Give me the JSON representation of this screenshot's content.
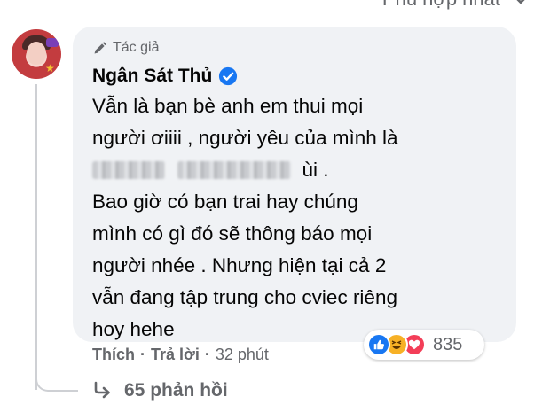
{
  "sort": {
    "label": "Phù hợp nhất"
  },
  "comment": {
    "badge_label": "Tác giả",
    "author": "Ngân Sát Thủ",
    "lines": [
      "Vẫn là bạn bè anh em thui mọi",
      "người ơiiii , người yêu của mình là",
      "ùi .",
      "Bao giờ có bạn trai hay chúng",
      "mình có gì đó sẽ thông báo mọi",
      "người nhée . Nhưng hiện tại cả 2",
      "vẫn đang tập trung cho cviec riêng",
      "hoy hehe"
    ],
    "reactions": {
      "icons": [
        "like-icon",
        "haha-icon",
        "love-icon"
      ],
      "count": "835"
    },
    "actions": {
      "like": "Thích",
      "reply": "Trả lời",
      "time": "32 phút"
    },
    "replies_label": "65 phản hồi"
  },
  "colors": {
    "bubble": "#f0f2f5",
    "secondary_text": "#65676b",
    "like_blue": "#1877f2",
    "love_red": "#f33e58",
    "haha_yellow": "#f7b125"
  }
}
